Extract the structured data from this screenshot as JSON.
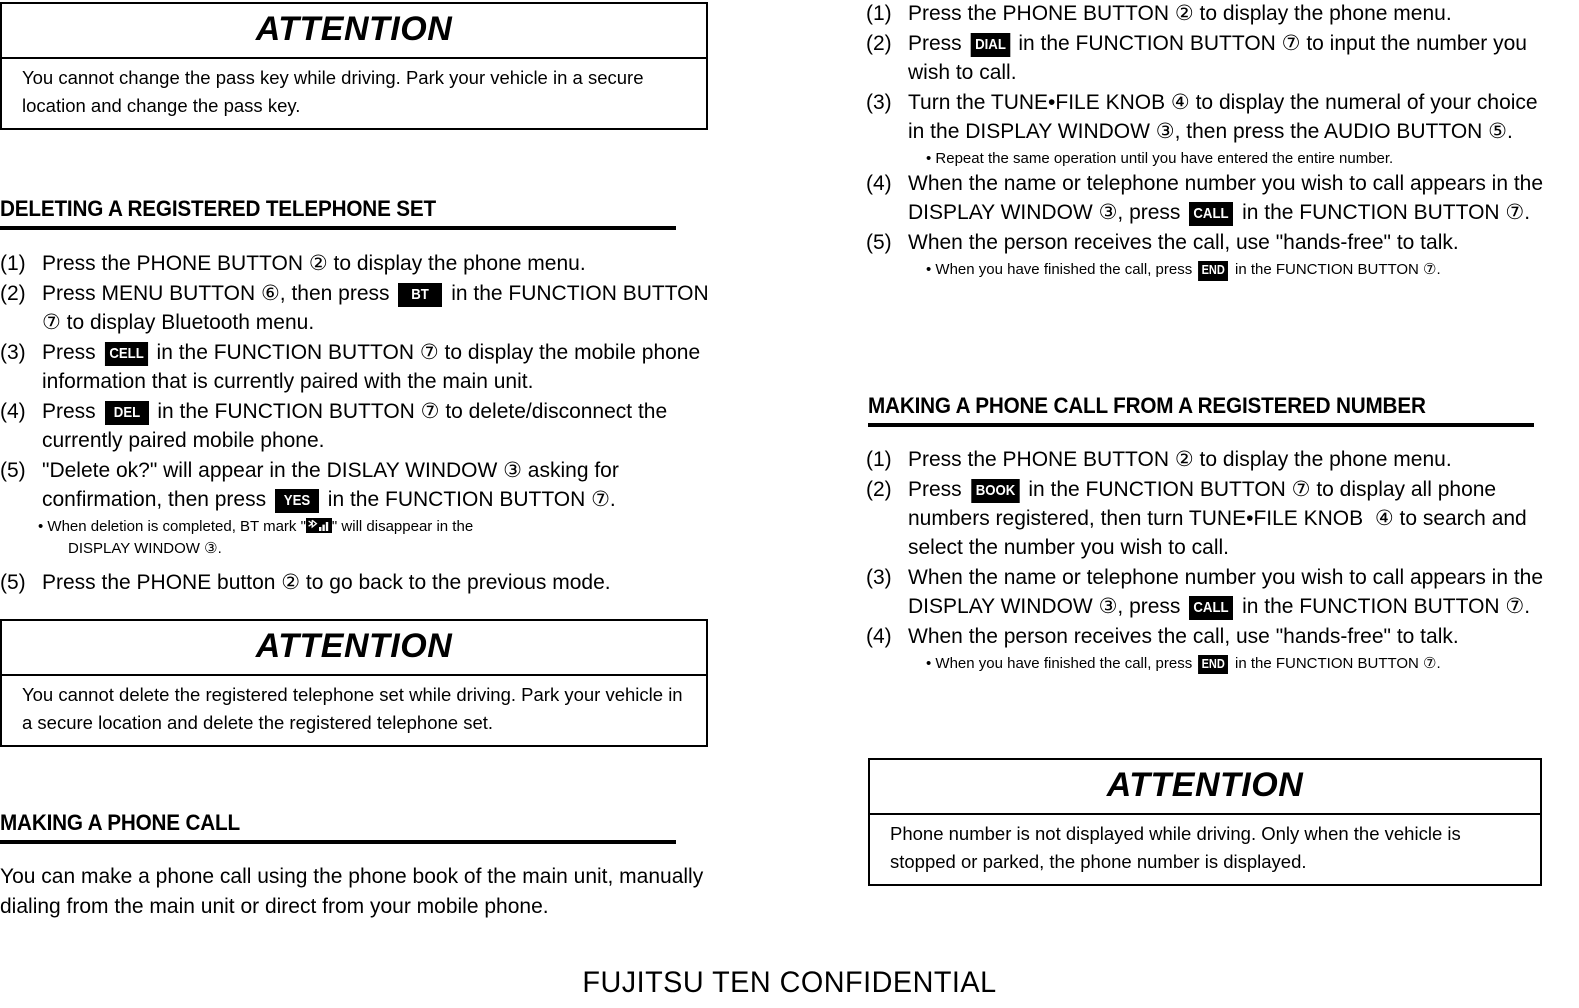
{
  "document": {
    "footer": "FUJITSU TEN CONFIDENTIAL"
  },
  "attention_top_left": {
    "title": "ATTENTION",
    "body": "You cannot change the pass key while driving. Park your vehicle in a secure location and change the pass key."
  },
  "section_deleting": {
    "heading": "DELETING A REGISTERED TELEPHONE SET",
    "steps": [
      {
        "num": "(1)",
        "parts": [
          {
            "type": "text",
            "value": "Press the PHONE BUTTON ② to display the phone menu."
          }
        ]
      },
      {
        "num": "(2)",
        "parts": [
          {
            "type": "text",
            "value": "Press MENU BUTTON ⑥, then press "
          },
          {
            "type": "key",
            "value": "BT",
            "wide": true
          },
          {
            "type": "text",
            "value": " in the FUNCTION BUTTON ⑦ to display Bluetooth menu."
          }
        ]
      },
      {
        "num": "(3)",
        "parts": [
          {
            "type": "text",
            "value": "Press "
          },
          {
            "type": "key",
            "value": "CELL"
          },
          {
            "type": "text",
            "value": " in the FUNCTION BUTTON ⑦ to display the mobile phone information that is currently paired with the main unit."
          }
        ]
      },
      {
        "num": "(4)",
        "parts": [
          {
            "type": "text",
            "value": "Press "
          },
          {
            "type": "key",
            "value": "DEL",
            "wide": true
          },
          {
            "type": "text",
            "value": " in the FUNCTION BUTTON ⑦ to delete/disconnect the currently paired mobile phone."
          }
        ]
      },
      {
        "num": "(5)",
        "parts": [
          {
            "type": "text",
            "value": "\"Delete ok?\" will appear in the DISLAY WINDOW ③ asking for confirmation, then press "
          },
          {
            "type": "key",
            "value": "YES",
            "wide": true
          },
          {
            "type": "text",
            "value": " in the FUNCTION BUTTON ⑦."
          }
        ]
      }
    ],
    "note_line_1_before": "• When deletion is completed, BT mark \"",
    "note_line_1_after": "\" will disappear in the",
    "note_line_2": "DISPLAY WINDOW ③.",
    "final_step": {
      "num": "(5)",
      "text": "Press the PHONE button ② to go back to the previous mode."
    }
  },
  "attention_bottom_left": {
    "title": "ATTENTION",
    "body": "You cannot delete the registered telephone set while driving. Park your vehicle in a secure location and delete the registered telephone set."
  },
  "section_making_call": {
    "heading": "MAKING A PHONE CALL",
    "paragraph": "You can make a phone call using the phone book of the main unit, manually dialing from the main unit or direct from your mobile phone."
  },
  "section_dial": {
    "steps": [
      {
        "num": "(1)",
        "parts": [
          {
            "type": "text",
            "value": "Press the PHONE BUTTON ② to display the phone menu."
          }
        ]
      },
      {
        "num": "(2)",
        "parts": [
          {
            "type": "text",
            "value": "Press "
          },
          {
            "type": "key",
            "value": "DIAL"
          },
          {
            "type": "text",
            "value": " in the FUNCTION BUTTON ⑦ to input the number you wish to call."
          }
        ]
      },
      {
        "num": "(3)",
        "parts": [
          {
            "type": "text",
            "value": "Turn the TUNE•FILE KNOB ④ to display the numeral of your choice in the DISPLAY WINDOW ③, then press the AUDIO BUTTON ⑤."
          }
        ]
      }
    ],
    "note_1": "• Repeat the same operation until you have entered the entire number.",
    "steps_cont": [
      {
        "num": "(4)",
        "parts": [
          {
            "type": "text",
            "value": "When the name or telephone number you wish to call appears in the DISPLAY WINDOW ③, press "
          },
          {
            "type": "key",
            "value": "CALL"
          },
          {
            "type": "text",
            "value": " in the FUNCTION BUTTON ⑦."
          }
        ]
      },
      {
        "num": "(5)",
        "parts": [
          {
            "type": "text",
            "value": "When the person receives the call, use \"hands-free\" to talk."
          }
        ]
      }
    ],
    "note_2_before": "• When you have finished the call, press ",
    "note_2_key": "END",
    "note_2_after": " in the FUNCTION BUTTON ⑦."
  },
  "section_registered": {
    "heading": "MAKING A PHONE CALL FROM A REGISTERED NUMBER",
    "steps": [
      {
        "num": "(1)",
        "parts": [
          {
            "type": "text",
            "value": "Press the PHONE BUTTON ② to display the phone menu."
          }
        ]
      },
      {
        "num": "(2)",
        "parts": [
          {
            "type": "text",
            "value": "Press "
          },
          {
            "type": "key",
            "value": "BOOK"
          },
          {
            "type": "text",
            "value": " in the FUNCTION BUTTON ⑦ to display all phone numbers registered, then turn TUNE•FILE KNOB  ④ to search and select the number you wish to call."
          }
        ]
      },
      {
        "num": "(3)",
        "parts": [
          {
            "type": "text",
            "value": "When the name or telephone number you wish to call appears in the DISPLAY WINDOW ③, press "
          },
          {
            "type": "key",
            "value": "CALL"
          },
          {
            "type": "text",
            "value": " in the FUNCTION BUTTON ⑦."
          }
        ]
      },
      {
        "num": "(4)",
        "parts": [
          {
            "type": "text",
            "value": "When the person receives the call, use \"hands-free\" to talk."
          }
        ]
      }
    ],
    "note_before": "• When you have finished the call, press ",
    "note_key": "END",
    "note_after": " in the FUNCTION BUTTON ⑦."
  },
  "attention_bottom_right": {
    "title": "ATTENTION",
    "body": "Phone number is not displayed while driving. Only when the vehicle is stopped or parked, the phone number is displayed."
  },
  "icons": {
    "bt_mark": "bluetooth-signal-mark"
  }
}
